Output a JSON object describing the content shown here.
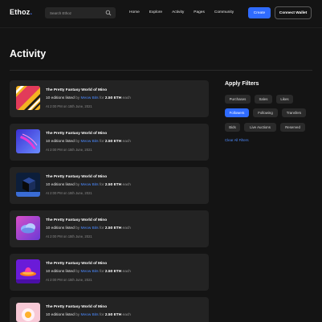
{
  "header": {
    "logo_main": "Ethoz",
    "logo_dot": ".",
    "search_placeholder": "Search Ethoz",
    "nav": [
      "Home",
      "Explore",
      "Activity",
      "Pages",
      "Community"
    ],
    "create_label": "Create",
    "wallet_label": "Connect Wallet"
  },
  "page": {
    "title": "Activity"
  },
  "activity": [
    {
      "title": "The Pretty Fantasy World of Mino",
      "count_text": "10 editions listed",
      "by_text": "by",
      "artist": "Meow Bits",
      "for_text": "for",
      "price": "2.50 ETH",
      "each_text": "each",
      "time": "At 2:00 PM on 15th June, 2021",
      "thumb": "stripes"
    },
    {
      "title": "The Pretty Fantasy World of Mino",
      "count_text": "10 editions listed",
      "by_text": "by",
      "artist": "Meow Bits",
      "for_text": "for",
      "price": "2.50 ETH",
      "each_text": "each",
      "time": "At 2:00 PM on 15th June, 2021",
      "thumb": "purple-swoosh"
    },
    {
      "title": "The Pretty Fantasy World of Mino",
      "count_text": "10 editions listed",
      "by_text": "by",
      "artist": "Meow Bits",
      "for_text": "for",
      "price": "2.50 ETH",
      "each_text": "each",
      "time": "At 2:00 PM on 15th June, 2021",
      "thumb": "dark-cube"
    },
    {
      "title": "The Pretty Fantasy World of Mino",
      "count_text": "10 editions listed",
      "by_text": "by",
      "artist": "Meow Bits",
      "for_text": "for",
      "price": "2.50 ETH",
      "each_text": "each",
      "time": "At 2:00 PM on 15th June, 2021",
      "thumb": "cloud"
    },
    {
      "title": "The Pretty Fantasy World of Mino",
      "count_text": "10 editions listed",
      "by_text": "by",
      "artist": "Meow Bits",
      "for_text": "for",
      "price": "2.50 ETH",
      "each_text": "each",
      "time": "At 2:00 PM on 15th June, 2021",
      "thumb": "purple-disc"
    },
    {
      "title": "The Pretty Fantasy World of Mino",
      "count_text": "10 editions listed",
      "by_text": "by",
      "artist": "Meow Bits",
      "for_text": "for",
      "price": "2.50 ETH",
      "each_text": "each",
      "time": "",
      "thumb": "pink-flower"
    }
  ],
  "filters": {
    "title": "Apply Filters",
    "chips": [
      {
        "label": "Purchases",
        "active": false
      },
      {
        "label": "Sales",
        "active": false
      },
      {
        "label": "Likes",
        "active": false
      },
      {
        "label": "Followers",
        "active": true
      },
      {
        "label": "Following",
        "active": false
      },
      {
        "label": "Transfers",
        "active": false
      },
      {
        "label": "Bids",
        "active": false
      },
      {
        "label": "Live Auctions",
        "active": false
      },
      {
        "label": "Reserved",
        "active": false
      }
    ],
    "clear_label": "Clear All Filters"
  },
  "colors": {
    "accent": "#2f6bff",
    "link": "#4d8bff",
    "card": "#232323",
    "background": "#141414"
  }
}
